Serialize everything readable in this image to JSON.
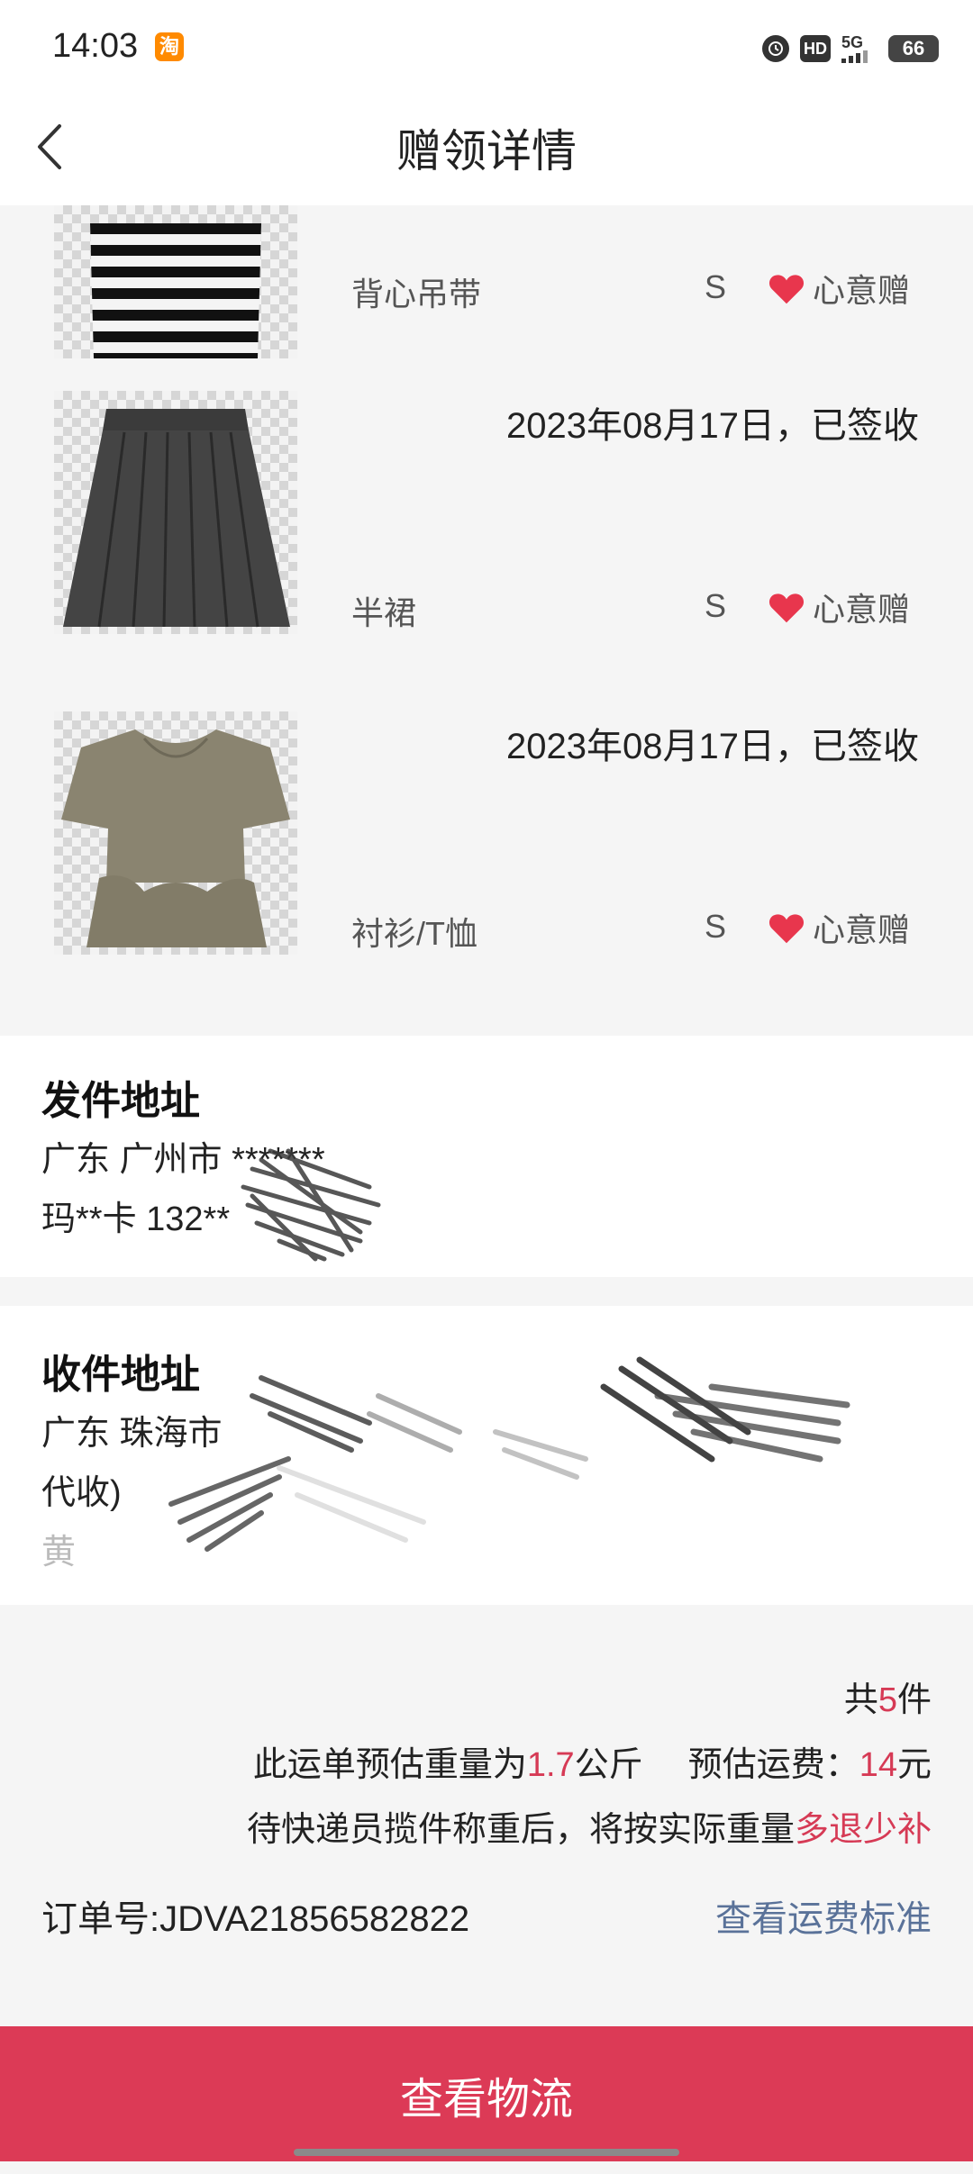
{
  "status_bar": {
    "time": "14:03",
    "app_icon": "淘",
    "hd": "HD",
    "network": "5G",
    "battery": "66"
  },
  "header": {
    "title": "赠领详情"
  },
  "items": [
    {
      "date": "",
      "name": "背心吊带",
      "size": "S",
      "gift": "心意赠",
      "image": "striped-top"
    },
    {
      "date": "2023年08月17日，已签收",
      "name": "半裙",
      "size": "S",
      "gift": "心意赠",
      "image": "pleated-skirt"
    },
    {
      "date": "2023年08月17日，已签收",
      "name": "衬衫/T恤",
      "size": "S",
      "gift": "心意赠",
      "image": "khaki-blouse"
    }
  ],
  "sender": {
    "title": "发件地址",
    "line1": "广东 广州市 *******",
    "line2": "玛**卡 132**"
  },
  "receiver": {
    "title": "收件地址",
    "line1": "广东 珠海市",
    "line2": "代收)",
    "line3": "黄"
  },
  "summary": {
    "count_prefix": "共",
    "count": "5",
    "count_suffix": "件",
    "weight_prefix": "此运单预估重量为",
    "weight": "1.7",
    "weight_unit": "公斤",
    "fee_label": "预估运费：",
    "fee": "14",
    "fee_unit": "元",
    "note_prefix": "待快递员揽件称重后，将按实际重量",
    "note_highlight": "多退少补",
    "order_label": "订单号:",
    "order_number": "JDVA21856582822",
    "fee_standard_link": "查看运费标准"
  },
  "bottom_button": {
    "label": "查看物流"
  },
  "colors": {
    "accent": "#dc3a56",
    "link": "#5a7299",
    "heart": "#e8364d"
  }
}
